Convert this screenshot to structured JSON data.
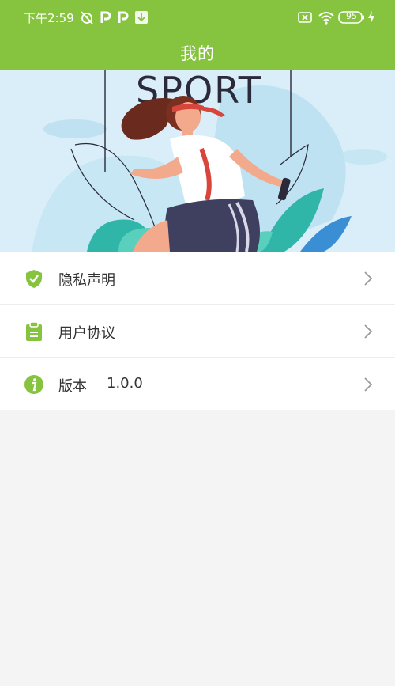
{
  "status_bar": {
    "time": "下午2:59",
    "battery": "95",
    "icons": [
      "alarm-off-icon",
      "p-app-icon",
      "p-app-icon",
      "download-icon",
      "sim-off-icon",
      "wifi-icon",
      "battery-icon",
      "charging-icon"
    ]
  },
  "header": {
    "title": "我的"
  },
  "banner": {
    "text": "SPORT"
  },
  "menu": {
    "items": [
      {
        "label": "隐私声明",
        "icon": "shield-check-icon"
      },
      {
        "label": "用户协议",
        "icon": "clipboard-icon"
      },
      {
        "label": "版本",
        "value": "1.0.0",
        "icon": "info-icon"
      }
    ]
  },
  "colors": {
    "accent": "#86c440",
    "background": "#f4f4f4",
    "text": "#333333"
  }
}
